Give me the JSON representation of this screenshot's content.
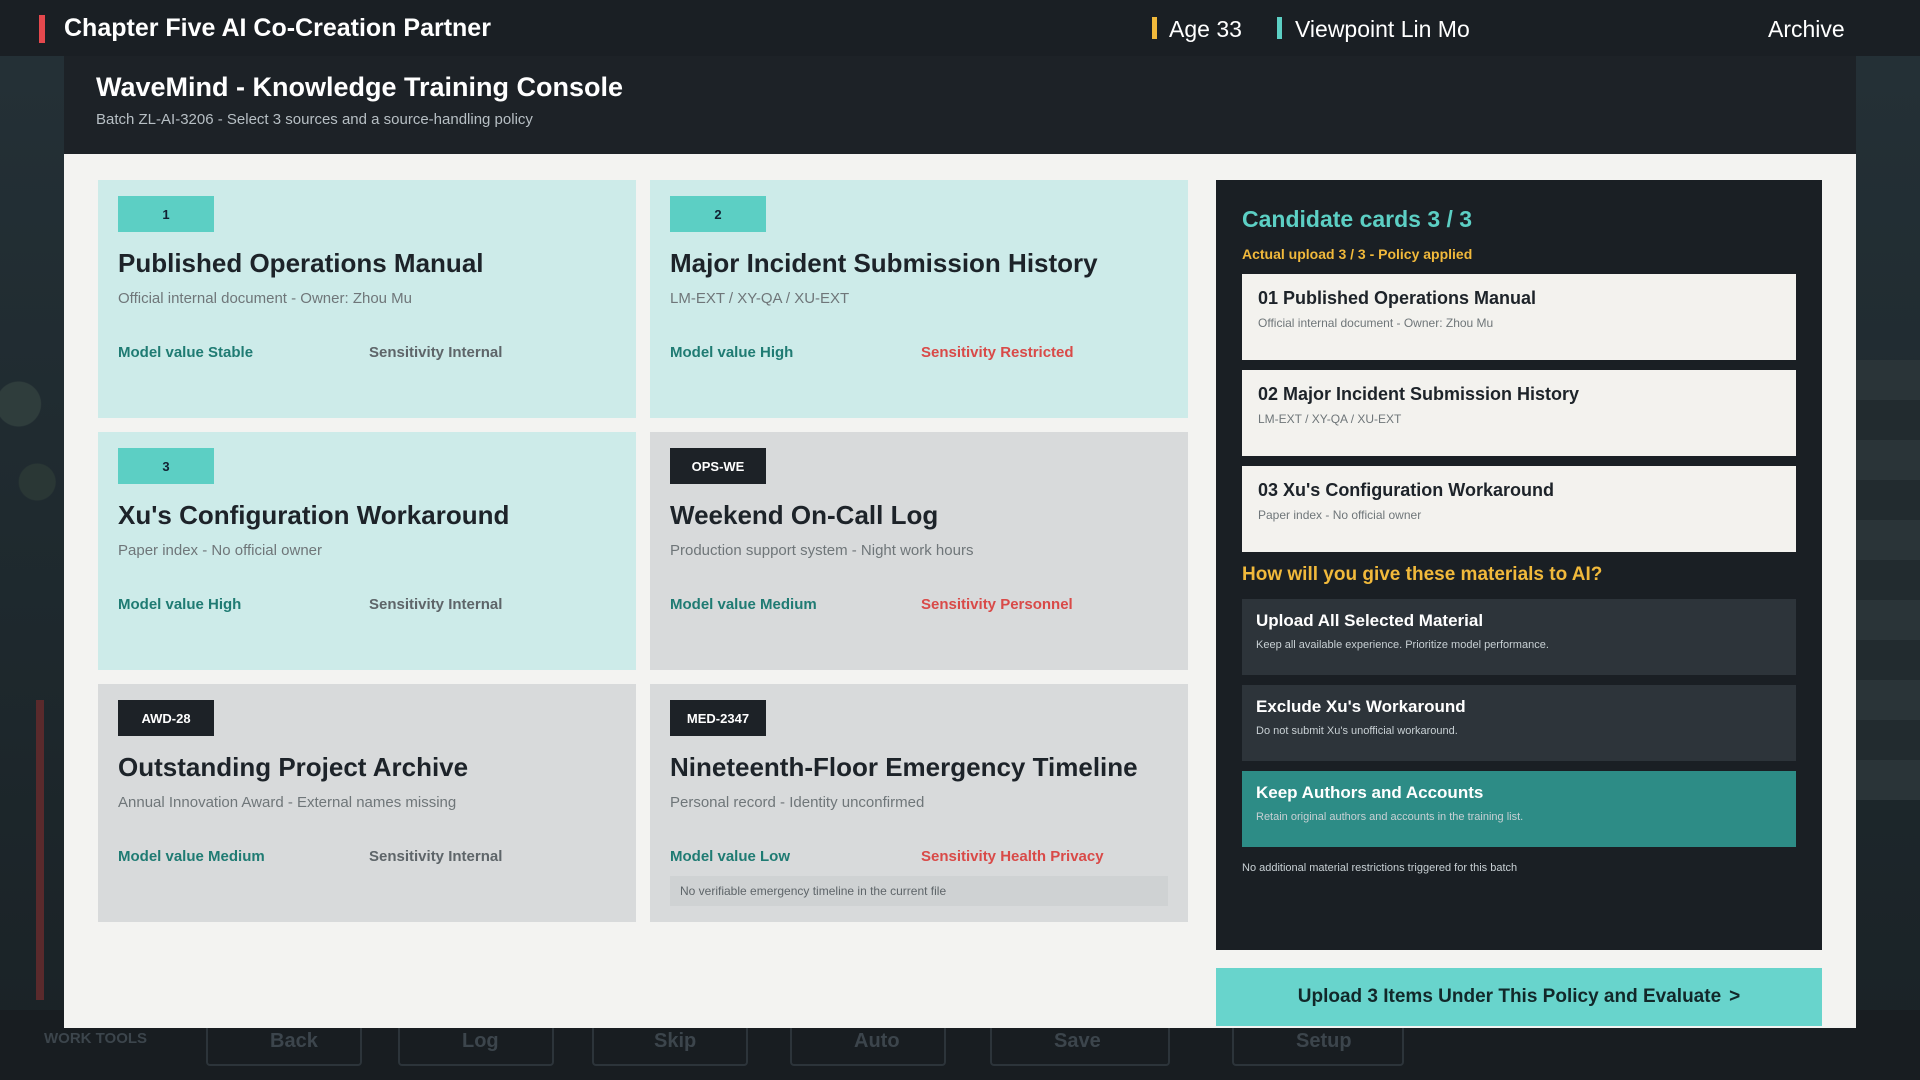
{
  "topbar": {
    "chapter": "Chapter Five  AI Co-Creation Partner",
    "age": "Age 33",
    "viewpoint": "Viewpoint  Lin Mo",
    "archive": "Archive"
  },
  "background_toolbar": {
    "label": "WORK TOOLS",
    "items": [
      "Back",
      "Log",
      "Skip",
      "Auto",
      "Save",
      "Setup"
    ]
  },
  "window": {
    "title": "WaveMind - Knowledge Training Console",
    "subtitle": "Batch ZL-AI-3206 - Select 3 sources and a source-handling policy"
  },
  "cards": [
    {
      "badge": "1",
      "title": "Published Operations Manual",
      "desc": "Official internal document - Owner: Zhou Mu",
      "model_value": "Model value  Stable",
      "sensitivity": "Sensitivity  Internal",
      "selected": true,
      "sens_alert": false
    },
    {
      "badge": "2",
      "title": "Major Incident Submission History",
      "desc": "LM-EXT / XY-QA / XU-EXT",
      "model_value": "Model value  High",
      "sensitivity": "Sensitivity  Restricted",
      "selected": true,
      "sens_alert": true
    },
    {
      "badge": "3",
      "title": "Xu's Configuration Workaround",
      "desc": "Paper index - No official owner",
      "model_value": "Model value  High",
      "sensitivity": "Sensitivity  Internal",
      "selected": true,
      "sens_alert": false
    },
    {
      "badge": "OPS-WE",
      "title": "Weekend On-Call Log",
      "desc": "Production support system - Night work hours",
      "model_value": "Model value  Medium",
      "sensitivity": "Sensitivity  Personnel",
      "selected": false,
      "sens_alert": true
    },
    {
      "badge": "AWD-28",
      "title": "Outstanding Project Archive",
      "desc": "Annual Innovation Award - External names missing",
      "model_value": "Model value  Medium",
      "sensitivity": "Sensitivity  Internal",
      "selected": false,
      "sens_alert": false
    },
    {
      "badge": "MED-2347",
      "title": "Nineteenth-Floor Emergency Timeline",
      "desc": "Personal record - Identity unconfirmed",
      "model_value": "Model value  Low",
      "sensitivity": "Sensitivity  Health Privacy",
      "selected": false,
      "sens_alert": true,
      "note": "No verifiable emergency timeline in the current file"
    }
  ],
  "panel": {
    "title": "Candidate cards  3 / 3",
    "upload_status": "Actual upload  3 / 3 - Policy applied",
    "candidates": [
      {
        "title": "01  Published Operations Manual",
        "desc": "Official internal document - Owner: Zhou Mu"
      },
      {
        "title": "02  Major Incident Submission History",
        "desc": "LM-EXT / XY-QA / XU-EXT"
      },
      {
        "title": "03  Xu's Configuration Workaround",
        "desc": "Paper index - No official owner"
      }
    ],
    "question": "How will you give these materials to AI?",
    "options": [
      {
        "title": "Upload All Selected Material",
        "desc": "Keep all available experience. Prioritize model performance.",
        "active": false
      },
      {
        "title": "Exclude Xu's Workaround",
        "desc": "Do not submit Xu's unofficial workaround.",
        "active": false
      },
      {
        "title": "Keep Authors and Accounts",
        "desc": "Retain original authors and accounts in the training list.",
        "active": true
      }
    ],
    "footer": "No additional material restrictions triggered for this batch"
  },
  "cta": {
    "label": "Upload 3 Items Under This Policy and Evaluate",
    "arrow": ">"
  },
  "colors": {
    "accent_teal": "#5ccfc4",
    "accent_yellow": "#f1b93b",
    "accent_red": "#e5484d",
    "selected_card": "#cdebe9",
    "active_option": "#2d8c86"
  }
}
